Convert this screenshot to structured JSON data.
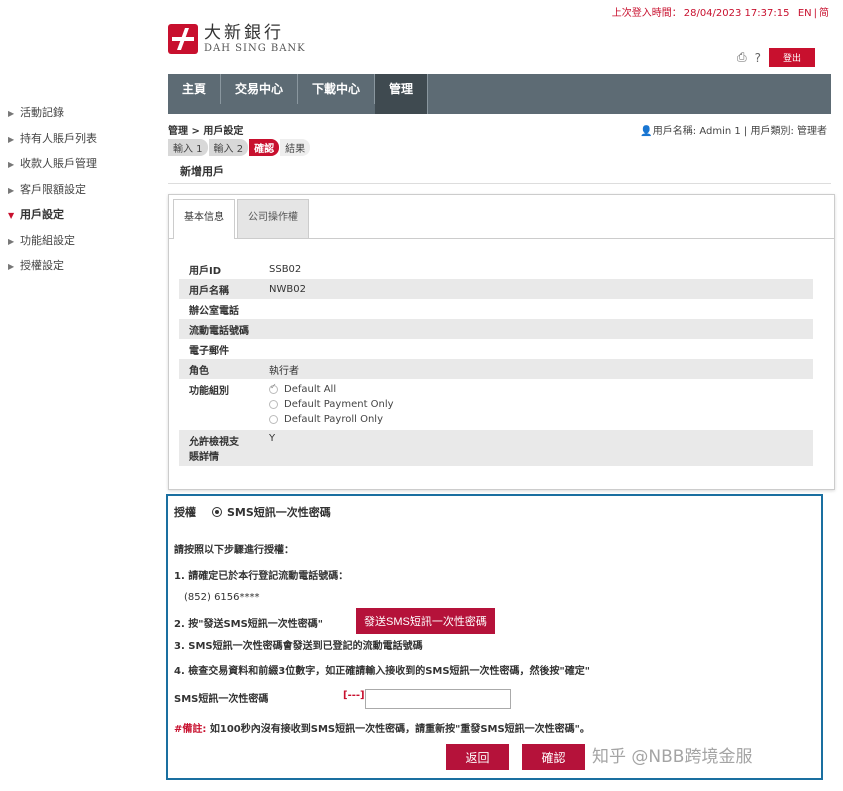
{
  "top": {
    "last_login_label": "上次登入時間：",
    "last_login_time": "28/04/2023 17:37:15",
    "lang_en": "EN",
    "lang_sep": "|",
    "lang_other": "简"
  },
  "brand": {
    "name_cn": "大新銀行",
    "name_en": "DAH SING BANK",
    "color": "#c8102e"
  },
  "toolbar": {
    "print_icon": "⎙",
    "help_icon": "?",
    "logout_label": "登出"
  },
  "nav": {
    "items": [
      {
        "label": "主頁"
      },
      {
        "label": "交易中心"
      },
      {
        "label": "下載中心"
      },
      {
        "label": "管理"
      }
    ],
    "active_index": 3
  },
  "sidebar": {
    "items": [
      {
        "label": "活動記錄"
      },
      {
        "label": "持有人賬戶列表"
      },
      {
        "label": "收款人賬戶管理"
      },
      {
        "label": "客戶限額設定"
      },
      {
        "label": "用戶設定"
      },
      {
        "label": "功能組設定"
      },
      {
        "label": "授權設定"
      }
    ],
    "active_index": 4
  },
  "breadcrumb": "管理 > 用戶設定",
  "user_info": "用戶名稱: Admin 1 | 用戶類別: 管理者",
  "steps": [
    {
      "label": "輸入 1"
    },
    {
      "label": "輸入 2"
    },
    {
      "label": "確認"
    },
    {
      "label": "結果"
    }
  ],
  "page_subtitle": "新增用戶",
  "tabs": [
    {
      "label": "基本信息"
    },
    {
      "label": "公司操作權"
    }
  ],
  "info": {
    "user_id_label": "用戶ID",
    "user_id_value": "SSB02",
    "user_name_label": "用戶名稱",
    "user_name_value": "NWB02",
    "office_phone_label": "辦公室電話",
    "office_phone_value": "",
    "mobile_label": "流動電話號碼",
    "mobile_value": "",
    "email_label": "電子郵件",
    "email_value": "",
    "role_label": "角色",
    "role_value": "執行者",
    "func_group_label": "功能組別",
    "func_options": [
      {
        "label": "Default All",
        "checked": true
      },
      {
        "label": "Default Payment Only",
        "checked": false
      },
      {
        "label": "Default Payroll Only",
        "checked": false
      }
    ],
    "allow_view_label_1": "允許檢視支",
    "allow_view_label_2": "賬詳情",
    "allow_view_value": "Y"
  },
  "auth": {
    "label": "授權",
    "method": "SMS短訊一次性密碼",
    "instruction": "請按照以下步驟進行授權：",
    "step1": "1. 請確定已於本行登記流動電話號碼：",
    "phone": "(852) 6156****",
    "step2": "2. 按\"發送SMS短訊一次性密碼\"",
    "send_button": "發送SMS短訊一次性密碼",
    "step3": "3. SMS短訊一次性密碼會發送到已登記的流動電話號碼",
    "step4": "4. 檢查交易資料和前綴3位數字，如正確請輸入接收到的SMS短訊一次性密碼，然後按\"確定\"",
    "otp_label": "SMS短訊一次性密碼",
    "otp_prefix": "[---]",
    "otp_value": "",
    "note_prefix": "#備註:",
    "note": "如100秒內沒有接收到SMS短訊一次性密碼，請重新按\"重發SMS短訊一次性密碼\"。",
    "back_button": "返回",
    "confirm_button": "確認"
  },
  "watermark": "知乎 @NBB跨境金服"
}
